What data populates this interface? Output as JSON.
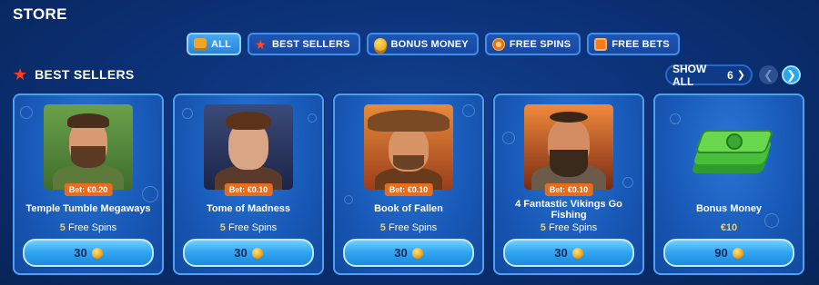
{
  "header": {
    "title": "STORE"
  },
  "tabs": [
    {
      "label": "ALL",
      "icon": "chest-icon",
      "active": true
    },
    {
      "label": "BEST SELLERS",
      "icon": "star-icon"
    },
    {
      "label": "BONUS MONEY",
      "icon": "coins-icon"
    },
    {
      "label": "FREE SPINS",
      "icon": "spin-icon"
    },
    {
      "label": "FREE BETS",
      "icon": "ticket-icon"
    }
  ],
  "section": {
    "title": "BEST SELLERS",
    "show_all_label": "SHOW ALL",
    "show_all_count": "6"
  },
  "cards": [
    {
      "name": "Temple Tumble Megaways",
      "bet": "Bet: €0.20",
      "spins_count": "5",
      "spins_label": "Free Spins",
      "price": "30"
    },
    {
      "name": "Tome of Madness",
      "bet": "Bet: €0.10",
      "spins_count": "5",
      "spins_label": "Free Spins",
      "price": "30"
    },
    {
      "name": "Book of Fallen",
      "bet": "Bet: €0.10",
      "spins_count": "5",
      "spins_label": "Free Spins",
      "price": "30"
    },
    {
      "name": "4 Fantastic Vikings Go Fishing",
      "bet": "Bet: €0.10",
      "spins_count": "5",
      "spins_label": "Free Spins",
      "price": "30"
    },
    {
      "name": "Bonus Money",
      "value": "€10",
      "price": "90"
    }
  ],
  "colors": {
    "accent": "#2aa6f0",
    "badge": "#e76d1d",
    "gold": "#ffd14a"
  }
}
